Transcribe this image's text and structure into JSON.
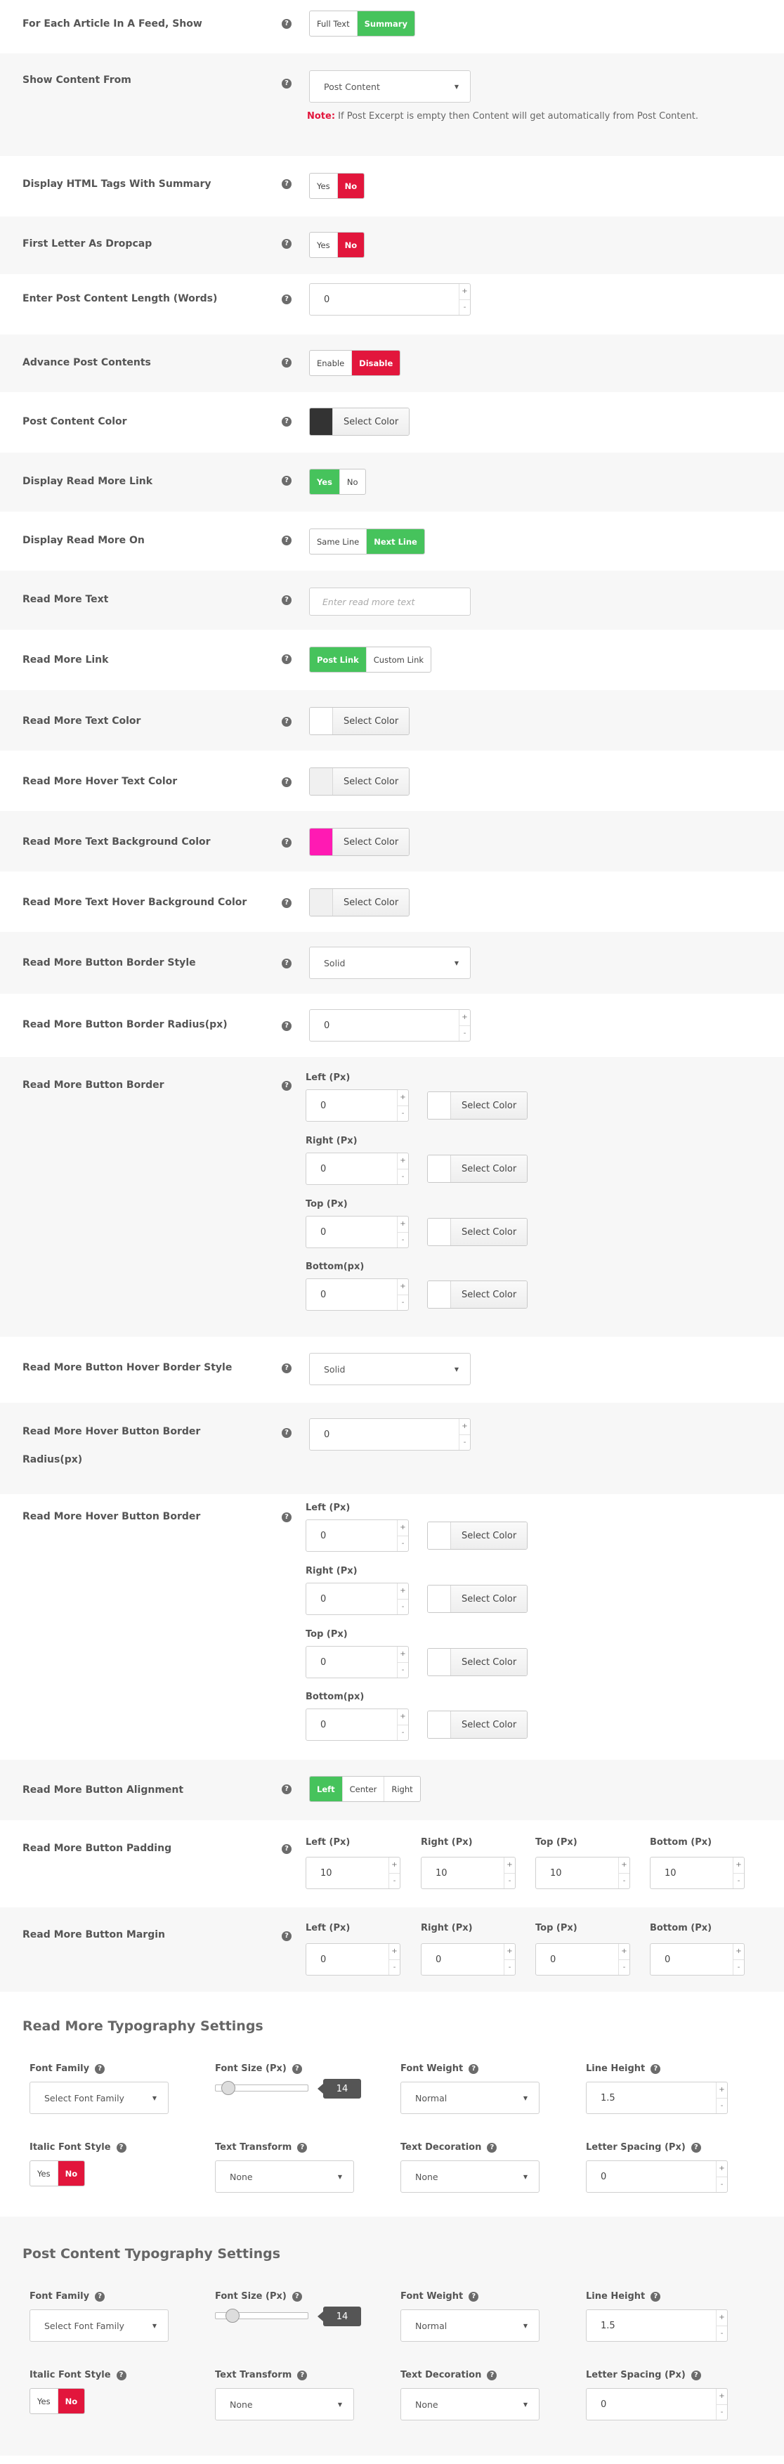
{
  "help": "?",
  "up": "+",
  "down": "-",
  "select_color": "Select Color",
  "rows": {
    "each_article": {
      "label": "For Each Article In A Feed, Show",
      "opts": [
        "Full Text",
        "Summary"
      ]
    },
    "show_content": {
      "label": "Show Content From",
      "value": "Post Content",
      "note_label": "Note:",
      "note": " If Post Excerpt is empty then Content will get automatically from Post Content."
    },
    "html_tags": {
      "label": "Display HTML Tags With Summary",
      "opts": [
        "Yes",
        "No"
      ]
    },
    "dropcap": {
      "label": "First Letter As Dropcap",
      "opts": [
        "Yes",
        "No"
      ]
    },
    "content_length": {
      "label": "Enter Post Content Length (Words)",
      "value": "0"
    },
    "advance": {
      "label": "Advance Post Contents",
      "opts": [
        "Enable",
        "Disable"
      ]
    },
    "content_color": {
      "label": "Post Content Color",
      "swatch": "#333333"
    },
    "read_more_link": {
      "label": "Display Read More Link",
      "opts": [
        "Yes",
        "No"
      ]
    },
    "read_more_on": {
      "label": "Display Read More On",
      "opts": [
        "Same Line",
        "Next Line"
      ]
    },
    "read_more_text": {
      "label": "Read More Text",
      "placeholder": "Enter read more text"
    },
    "read_more_link_type": {
      "label": "Read More Link",
      "opts": [
        "Post Link",
        "Custom Link"
      ]
    },
    "rm_text_color": {
      "label": "Read More Text Color",
      "swatch": "#ffffff"
    },
    "rm_hover_text_color": {
      "label": "Read More Hover Text Color",
      "swatch": "#f0f0f0"
    },
    "rm_bg_color": {
      "label": "Read More Text Background Color",
      "swatch": "#ff1ab3"
    },
    "rm_hover_bg_color": {
      "label": "Read More Text Hover Background Color",
      "swatch": "#f0f0f0"
    },
    "rm_border_style": {
      "label": "Read More Button Border Style",
      "value": "Solid"
    },
    "rm_border_radius": {
      "label": "Read More Button Border Radius(px)",
      "value": "0"
    },
    "rm_border": {
      "label": "Read More Button Border",
      "sides": [
        {
          "name": "Left (Px)",
          "value": "0"
        },
        {
          "name": "Right (Px)",
          "value": "0"
        },
        {
          "name": "Top (Px)",
          "value": "0"
        },
        {
          "name": "Bottom(px)",
          "value": "0"
        }
      ]
    },
    "rm_hover_border_style": {
      "label": "Read More Button Hover Border Style",
      "value": "Solid"
    },
    "rm_hover_border_radius": {
      "label1": "Read More Hover Button Border",
      "label2": "Radius(px)",
      "value": "0"
    },
    "rm_hover_border": {
      "label": "Read More Hover Button Border",
      "sides": [
        {
          "name": "Left (Px)",
          "value": "0"
        },
        {
          "name": "Right (Px)",
          "value": "0"
        },
        {
          "name": "Top (Px)",
          "value": "0"
        },
        {
          "name": "Bottom(px)",
          "value": "0"
        }
      ]
    },
    "rm_alignment": {
      "label": "Read More Button Alignment",
      "opts": [
        "Left",
        "Center",
        "Right"
      ]
    },
    "rm_padding": {
      "label": "Read More Button Padding",
      "sides": [
        {
          "name": "Left (Px)",
          "value": "10"
        },
        {
          "name": "Right (Px)",
          "value": "10"
        },
        {
          "name": "Top (Px)",
          "value": "10"
        },
        {
          "name": "Bottom (Px)",
          "value": "10"
        }
      ]
    },
    "rm_margin": {
      "label": "Read More Button Margin",
      "sides": [
        {
          "name": "Left (Px)",
          "value": "0"
        },
        {
          "name": "Right (Px)",
          "value": "0"
        },
        {
          "name": "Top (Px)",
          "value": "0"
        },
        {
          "name": "Bottom (Px)",
          "value": "0"
        }
      ]
    }
  },
  "typo1": {
    "title": "Read More Typography Settings",
    "font_family": "Font Family",
    "font_family_value": "Select Font Family",
    "font_size": "Font Size (Px)",
    "font_size_value": "14",
    "font_weight": "Font Weight",
    "font_weight_value": "Normal",
    "line_height": "Line Height",
    "line_height_value": "1.5",
    "italic": "Italic Font Style",
    "italic_opts": [
      "Yes",
      "No"
    ],
    "transform": "Text Transform",
    "transform_value": "None",
    "decoration": "Text Decoration",
    "decoration_value": "None",
    "spacing": "Letter Spacing (Px)",
    "spacing_value": "0"
  },
  "typo2": {
    "title": "Post Content Typography Settings",
    "font_family": "Font Family",
    "font_family_value": "Select Font Family",
    "font_size": "Font Size (Px)",
    "font_size_value": "14",
    "font_weight": "Font Weight",
    "font_weight_value": "Normal",
    "line_height": "Line Height",
    "line_height_value": "1.5",
    "italic": "Italic Font Style",
    "italic_opts": [
      "Yes",
      "No"
    ],
    "transform": "Text Transform",
    "transform_value": "None",
    "decoration": "Text Decoration",
    "decoration_value": "None",
    "spacing": "Letter Spacing (Px)",
    "spacing_value": "0"
  },
  "colors": {
    "green": "#46c35c",
    "red": "#e2163c",
    "row_alt": "#f7f7f7"
  }
}
